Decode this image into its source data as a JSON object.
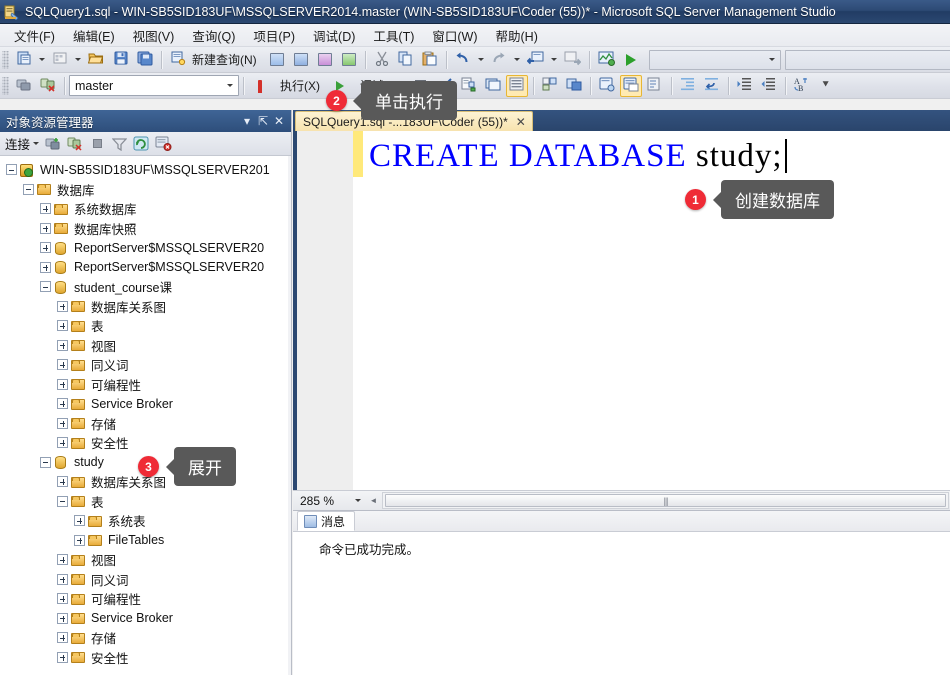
{
  "window": {
    "title": "SQLQuery1.sql - WIN-SB5SID183UF\\MSSQLSERVER2014.master (WIN-SB5SID183UF\\Coder (55))* - Microsoft SQL Server Management Studio",
    "app_icon": "ssms-icon"
  },
  "menu": {
    "items": [
      {
        "label": "文件(F)"
      },
      {
        "label": "编辑(E)"
      },
      {
        "label": "视图(V)"
      },
      {
        "label": "查询(Q)"
      },
      {
        "label": "项目(P)"
      },
      {
        "label": "调试(D)"
      },
      {
        "label": "工具(T)"
      },
      {
        "label": "窗口(W)"
      },
      {
        "label": "帮助(H)"
      }
    ]
  },
  "toolbar1": {
    "new_query_label": "新建查询(N)"
  },
  "toolbar2": {
    "database_value": "master",
    "execute_label": "执行(X)",
    "debug_label": "调试(D)"
  },
  "object_explorer": {
    "title": "对象资源管理器",
    "connect_label": "连接",
    "tree": [
      {
        "label": "WIN-SB5SID183UF\\MSSQLSERVER201",
        "indent": 0,
        "state": "minus",
        "icon": "server-icon"
      },
      {
        "label": "数据库",
        "indent": 1,
        "state": "minus",
        "icon": "folder-icon"
      },
      {
        "label": "系统数据库",
        "indent": 2,
        "state": "plus",
        "icon": "folder-icon"
      },
      {
        "label": "数据库快照",
        "indent": 2,
        "state": "plus",
        "icon": "folder-icon"
      },
      {
        "label": "ReportServer$MSSQLSERVER20",
        "indent": 2,
        "state": "plus",
        "icon": "database-icon"
      },
      {
        "label": "ReportServer$MSSQLSERVER20",
        "indent": 2,
        "state": "plus",
        "icon": "database-icon"
      },
      {
        "label": "student_course课",
        "indent": 2,
        "state": "minus",
        "icon": "database-icon"
      },
      {
        "label": "数据库关系图",
        "indent": 3,
        "state": "plus",
        "icon": "folder-icon"
      },
      {
        "label": "表",
        "indent": 3,
        "state": "plus",
        "icon": "folder-icon"
      },
      {
        "label": "视图",
        "indent": 3,
        "state": "plus",
        "icon": "folder-icon"
      },
      {
        "label": "同义词",
        "indent": 3,
        "state": "plus",
        "icon": "folder-icon"
      },
      {
        "label": "可编程性",
        "indent": 3,
        "state": "plus",
        "icon": "folder-icon"
      },
      {
        "label": "Service Broker",
        "indent": 3,
        "state": "plus",
        "icon": "folder-icon"
      },
      {
        "label": "存储",
        "indent": 3,
        "state": "plus",
        "icon": "folder-icon"
      },
      {
        "label": "安全性",
        "indent": 3,
        "state": "plus",
        "icon": "folder-icon"
      },
      {
        "label": "study",
        "indent": 2,
        "state": "minus",
        "icon": "database-icon"
      },
      {
        "label": "数据库关系图",
        "indent": 3,
        "state": "plus",
        "icon": "folder-icon"
      },
      {
        "label": "表",
        "indent": 3,
        "state": "minus",
        "icon": "folder-icon"
      },
      {
        "label": "系统表",
        "indent": 4,
        "state": "plus",
        "icon": "folder-icon"
      },
      {
        "label": "FileTables",
        "indent": 4,
        "state": "plus",
        "icon": "folder-icon"
      },
      {
        "label": "视图",
        "indent": 3,
        "state": "plus",
        "icon": "folder-icon"
      },
      {
        "label": "同义词",
        "indent": 3,
        "state": "plus",
        "icon": "folder-icon"
      },
      {
        "label": "可编程性",
        "indent": 3,
        "state": "plus",
        "icon": "folder-icon"
      },
      {
        "label": "Service Broker",
        "indent": 3,
        "state": "plus",
        "icon": "folder-icon"
      },
      {
        "label": "存储",
        "indent": 3,
        "state": "plus",
        "icon": "folder-icon"
      },
      {
        "label": "安全性",
        "indent": 3,
        "state": "plus",
        "icon": "folder-icon"
      }
    ]
  },
  "editor": {
    "tab_label": "SQLQuery1.sql -...183UF\\Coder (55))*",
    "tab_close": "✕",
    "code_keyword": "CREATE DATABASE",
    "code_identifier": " study;",
    "zoom_level": "285 %"
  },
  "results": {
    "tab_label": "消息",
    "message": "命令已成功完成。"
  },
  "annotations": [
    {
      "number": "1",
      "label": "创建数据库"
    },
    {
      "number": "2",
      "label": "单击执行"
    },
    {
      "number": "3",
      "label": "展开"
    }
  ],
  "colors": {
    "accent_blue": "#2b4871",
    "badge_red": "#ef2b36",
    "callout_gray": "#595959",
    "keyword_blue": "#0000ff",
    "change_bar_yellow": "#ffe97a"
  }
}
